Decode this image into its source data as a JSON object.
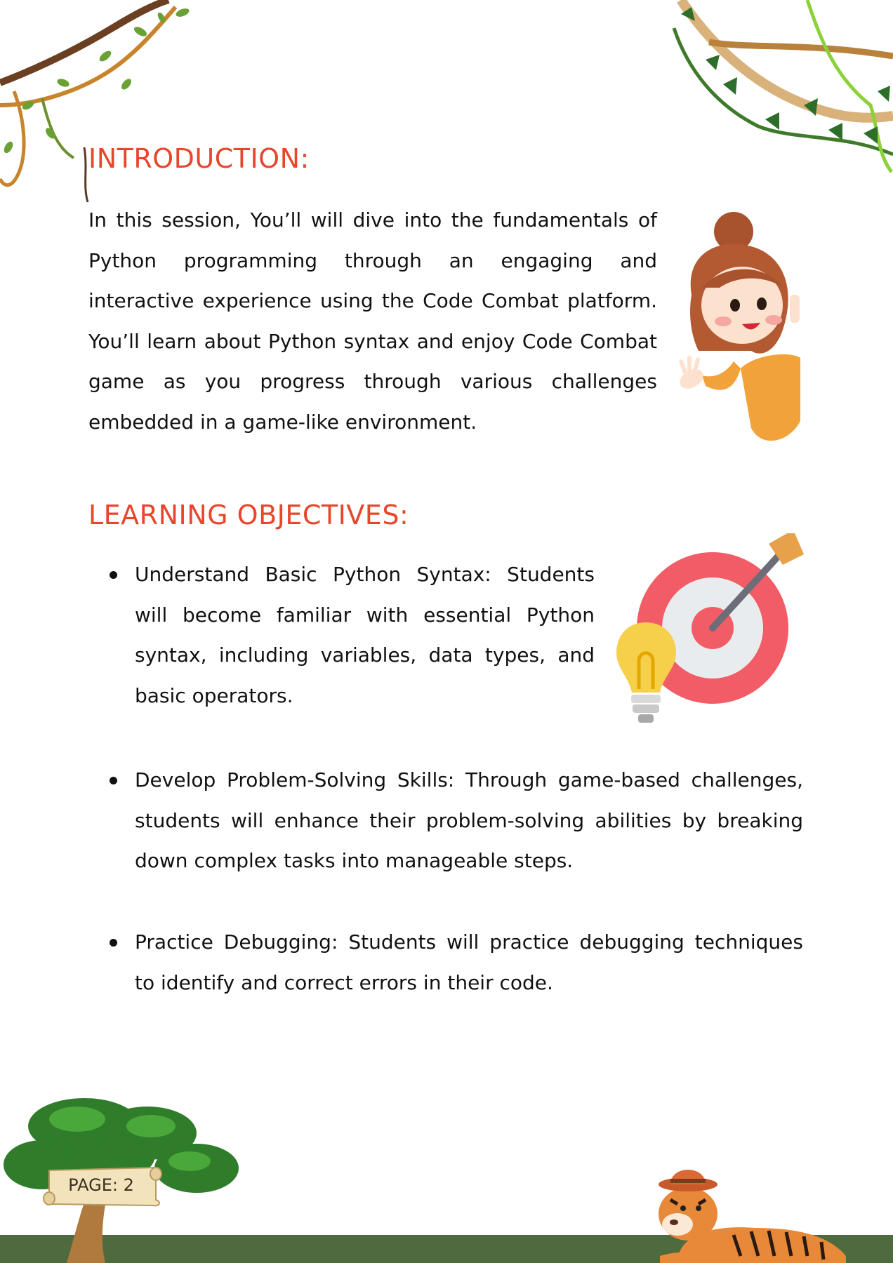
{
  "introduction": {
    "heading": "INTRODUCTION:",
    "body": "In this session, You’ll will dive into the fundamentals of Python programming through an engaging and interactive experience using the Code Combat platform. You’ll learn about Python syntax and enjoy Code Combat game as you progress through various challenges embedded in a game-like environment."
  },
  "learning_objectives": {
    "heading": "LEARNING OBJECTIVES:",
    "items": [
      {
        "text": "Understand Basic Python Syntax: Students will become familiar with essential Python syntax, including variables, data types, and basic operators."
      },
      {
        "text": "Develop Problem-Solving Skills: Through game-based challenges, students will enhance their problem-solving abilities by breaking down complex tasks into manageable steps."
      },
      {
        "text": "Practice Debugging: Students will practice debugging techniques to identify and correct errors in their code."
      }
    ]
  },
  "footer": {
    "page_label": "PAGE: 2"
  },
  "colors": {
    "heading": "#e8462c",
    "text": "#111111",
    "ground": "#4e6a3e"
  },
  "icons": [
    "vine-decoration-icon",
    "girl-waving-icon",
    "target-arrow-icon",
    "lightbulb-icon",
    "tree-icon",
    "scroll-sign-icon",
    "tiger-icon"
  ]
}
